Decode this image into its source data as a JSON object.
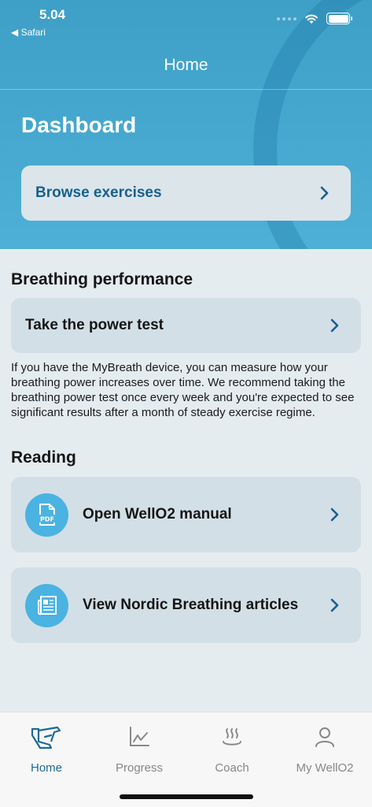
{
  "status": {
    "time": "5.04",
    "back_app": "◀ Safari"
  },
  "header": {
    "title": "Home"
  },
  "dashboard": {
    "title": "Dashboard",
    "browse_label": "Browse exercises"
  },
  "breathing": {
    "heading": "Breathing performance",
    "power_test_label": "Take the power test",
    "description": "If you have the MyBreath device, you can measure how your breathing power increases over time. We recommend taking the breathing power test once every week and you're expected to see significant results after a month of steady exercise regime."
  },
  "reading": {
    "heading": "Reading",
    "items": [
      {
        "label": "Open WellO2 manual",
        "icon": "pdf-icon"
      },
      {
        "label": "View Nordic Breathing articles",
        "icon": "article-icon"
      }
    ]
  },
  "tabbar": {
    "active": "Home",
    "tabs": [
      {
        "label": "Home",
        "icon": "home-icon"
      },
      {
        "label": "Progress",
        "icon": "chart-icon"
      },
      {
        "label": "Coach",
        "icon": "steam-icon"
      },
      {
        "label": "My WellO2",
        "icon": "person-icon"
      }
    ]
  },
  "colors": {
    "hero": "#4eb0d6",
    "accent": "#16608f",
    "card": "#d3dfe6",
    "icon_bg": "#4ab3e2"
  }
}
